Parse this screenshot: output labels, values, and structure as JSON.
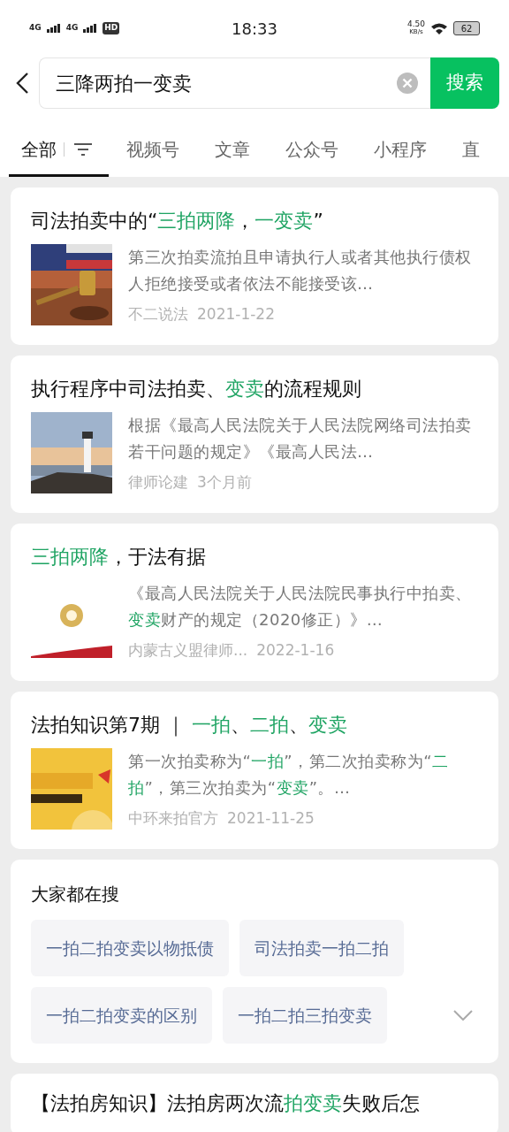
{
  "status_bar": {
    "network_1": "4G",
    "network_2": "4G",
    "hd": "HD",
    "time": "18:33",
    "speed": "4.50",
    "speed_unit": "KB/s",
    "battery": "62"
  },
  "search": {
    "value": "三降两拍一变卖",
    "button": "搜索"
  },
  "tabs": [
    {
      "label": "全部",
      "selected": true
    },
    {
      "label": "视频号",
      "selected": false
    },
    {
      "label": "文章",
      "selected": false
    },
    {
      "label": "公众号",
      "selected": false
    },
    {
      "label": "小程序",
      "selected": false
    },
    {
      "label": "直",
      "selected": false
    }
  ],
  "results": [
    {
      "title": [
        {
          "text": "司法拍卖中的“",
          "highlight": false
        },
        {
          "text": "三拍两降",
          "highlight": true
        },
        {
          "text": "，",
          "highlight": false
        },
        {
          "text": "一变卖",
          "highlight": true
        },
        {
          "text": "”",
          "highlight": false
        }
      ],
      "snippet": [
        {
          "text": "第三次拍卖流拍且申请执行人或者其他执行债权人拒绝接受或者依法不能接受该…",
          "highlight": false
        }
      ],
      "source": "不二说法",
      "date": "2021-1-22"
    },
    {
      "title": [
        {
          "text": "执行程序中司法拍卖、",
          "highlight": false
        },
        {
          "text": "变卖",
          "highlight": true
        },
        {
          "text": "的流程规则",
          "highlight": false
        }
      ],
      "snippet": [
        {
          "text": "根据《最高人民法院关于人民法院网络司法拍卖若干问题的规定》《最高人民法…",
          "highlight": false
        }
      ],
      "source": "律师论建",
      "date": "3个月前"
    },
    {
      "title": [
        {
          "text": "三拍两降",
          "highlight": true
        },
        {
          "text": "，于法有据",
          "highlight": false
        }
      ],
      "snippet": [
        {
          "text": "《最高人民法院关于人民法院民事执行中拍卖、",
          "highlight": false
        },
        {
          "text": "变卖",
          "highlight": true
        },
        {
          "text": "财产的规定（2020修正）》…",
          "highlight": false
        }
      ],
      "source": "内蒙古义盟律师...",
      "date": "2022-1-16"
    },
    {
      "title": [
        {
          "text": "法拍知识第7期 ｜ ",
          "highlight": false
        },
        {
          "text": "一拍",
          "highlight": true
        },
        {
          "text": "、",
          "highlight": false
        },
        {
          "text": "二拍",
          "highlight": true
        },
        {
          "text": "、",
          "highlight": false
        },
        {
          "text": "变卖",
          "highlight": true
        }
      ],
      "snippet": [
        {
          "text": "第一次拍卖称为“",
          "highlight": false
        },
        {
          "text": "一拍",
          "highlight": true
        },
        {
          "text": "”，第二次拍卖称为“",
          "highlight": false
        },
        {
          "text": "二拍",
          "highlight": true
        },
        {
          "text": "”，第三次拍卖为“",
          "highlight": false
        },
        {
          "text": "变卖",
          "highlight": true
        },
        {
          "text": "”。…",
          "highlight": false
        }
      ],
      "source": "中环来拍官方",
      "date": "2021-11-25"
    }
  ],
  "suggestions": {
    "title": "大家都在搜",
    "rows": [
      [
        "一拍二拍变卖以物抵债",
        "司法拍卖一拍二拍"
      ],
      [
        "一拍二拍变卖的区别",
        "一拍二拍三拍变卖"
      ]
    ]
  },
  "last_result": {
    "title": [
      {
        "text": "【法拍房知识】法拍房两次流",
        "highlight": false
      },
      {
        "text": "拍变卖",
        "highlight": true
      },
      {
        "text": "失败后怎",
        "highlight": false
      }
    ]
  }
}
